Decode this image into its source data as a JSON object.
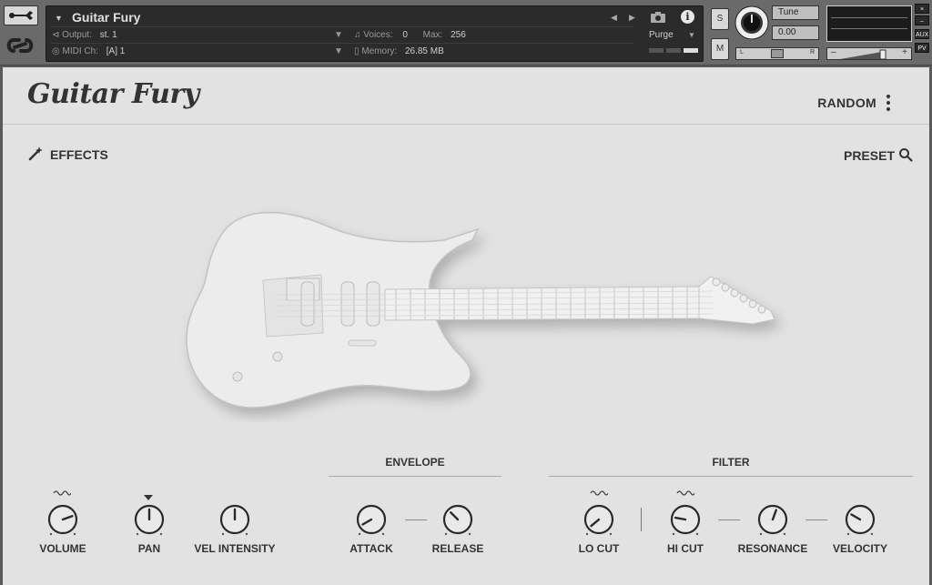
{
  "header": {
    "instrument_name": "Guitar Fury",
    "output_label": "Output:",
    "output_value": "st. 1",
    "voices_label": "Voices:",
    "voices_value": "0",
    "max_label": "Max:",
    "max_value": "256",
    "midi_label": "MIDI Ch:",
    "midi_value": "[A]  1",
    "memory_label": "Memory:",
    "memory_value": "26.85 MB",
    "purge_label": "Purge",
    "solo_label": "S",
    "mute_label": "M",
    "tune_label": "Tune",
    "tune_value": "0.00",
    "pan_left": "L",
    "pan_right": "R",
    "vol_min": "–",
    "vol_max": "+",
    "side_close": "×",
    "side_min": "–",
    "side_aux": "AUX",
    "side_pv": "PV"
  },
  "ui": {
    "brand_title": "Guitar Fury",
    "random_label": "RANDOM",
    "effects_label": "EFFECTS",
    "preset_label": "PRESET",
    "envelope_title": "ENVELOPE",
    "filter_title": "FILTER",
    "knobs": {
      "volume": "VOLUME",
      "pan": "PAN",
      "vel_intensity": "VEL INTENSITY",
      "attack": "ATTACK",
      "release": "RELEASE",
      "lo_cut": "LO CUT",
      "hi_cut": "HI CUT",
      "resonance": "RESONANCE",
      "velocity": "VELOCITY"
    }
  },
  "icons": {
    "wrench": "wrench-icon",
    "logo": "brand-logo-icon",
    "camera": "camera-icon",
    "info": "info-icon",
    "effects": "magic-wand-icon",
    "preset_search": "search-icon",
    "random_menu": "vertical-dots-icon",
    "wave": "sine-wave-icon"
  },
  "colors": {
    "panel_bg": "#e2e2e2",
    "header_bg": "#6a6a6a",
    "instrument_panel": "#2b2b2b",
    "text_dark": "#333333"
  }
}
